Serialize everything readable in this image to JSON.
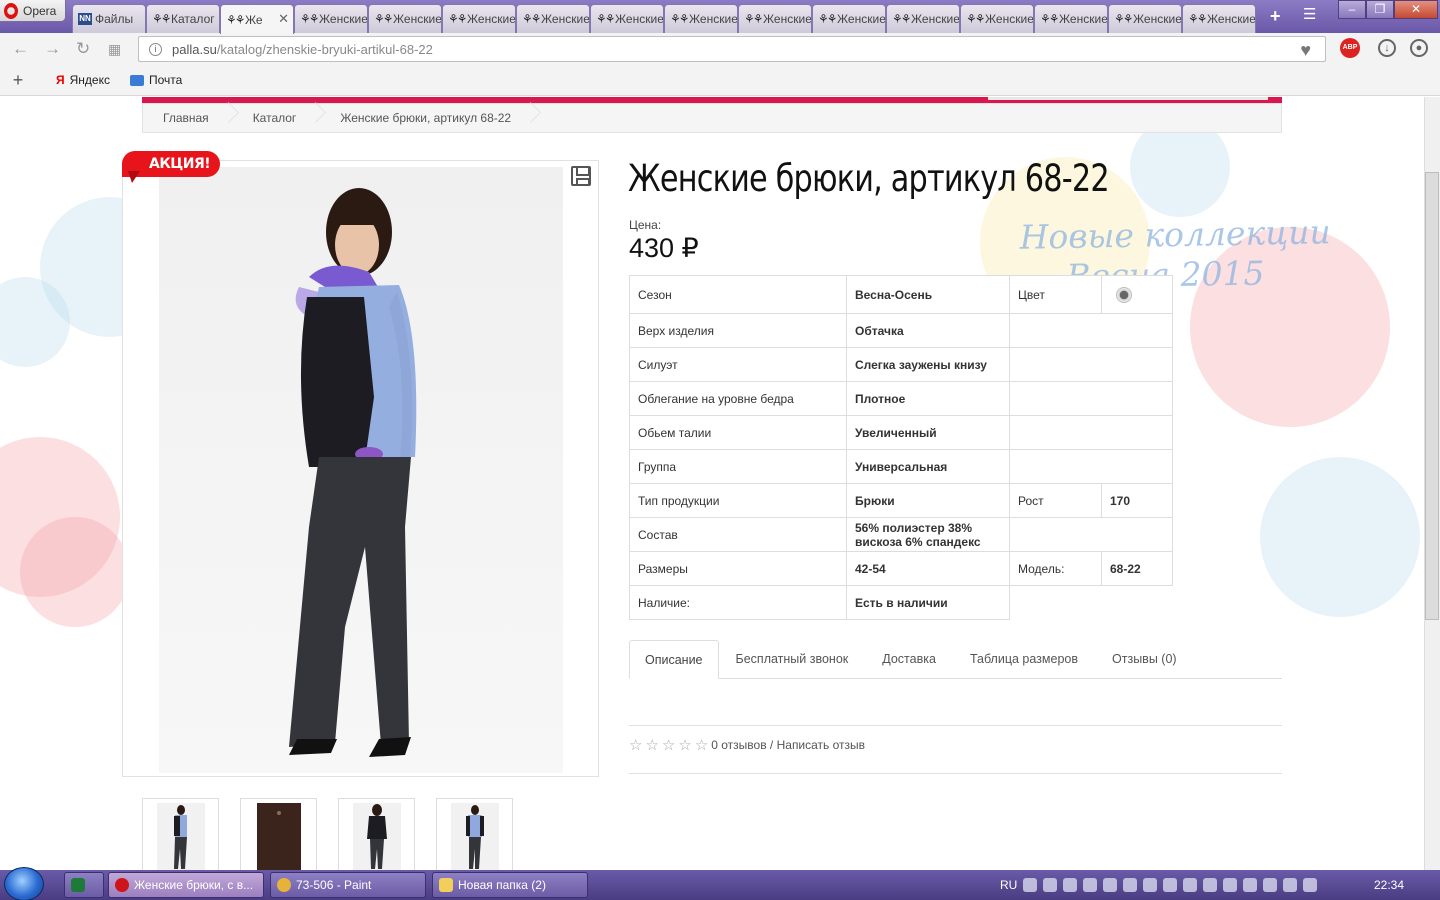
{
  "browser": {
    "menu_label": "Opera",
    "tabs": [
      {
        "icon": "nn",
        "label": "Файлы"
      },
      {
        "icon": "dress-icon",
        "label": "Каталог"
      },
      {
        "icon": "dress-icon",
        "label": "Же",
        "active": true
      },
      {
        "icon": "dress-icon",
        "label": "Женские"
      },
      {
        "icon": "dress-icon",
        "label": "Женские"
      },
      {
        "icon": "dress-icon",
        "label": "Женские"
      },
      {
        "icon": "dress-icon",
        "label": "Женские"
      },
      {
        "icon": "dress-icon",
        "label": "Женские"
      },
      {
        "icon": "dress-icon",
        "label": "Женские"
      },
      {
        "icon": "dress-icon",
        "label": "Женские"
      },
      {
        "icon": "dress-icon",
        "label": "Женские"
      },
      {
        "icon": "dress-icon",
        "label": "Женские"
      },
      {
        "icon": "dress-icon",
        "label": "Женские"
      },
      {
        "icon": "dress-icon",
        "label": "Женские"
      },
      {
        "icon": "dress-icon",
        "label": "Женские"
      },
      {
        "icon": "dress-icon",
        "label": "Женские"
      }
    ],
    "url_host": "palla.su",
    "url_path": "/katalog/zhenskie-bryuki-artikul-68-22",
    "bookmarks": [
      {
        "icon": "yandex-icon",
        "label": "Яндекс"
      },
      {
        "icon": "mail-icon",
        "label": "Почта"
      }
    ],
    "abp_label": "ABP"
  },
  "breadcrumb": [
    "Главная",
    "Каталог",
    "Женские брюки, артикул 68-22"
  ],
  "product": {
    "sale_badge": "АКЦИЯ!",
    "title": "Женские брюки, артикул 68-22",
    "price_label": "Цена:",
    "price": "430 ₽",
    "banner_line1": "Новые коллекции",
    "banner_line2": "Весна 2015",
    "specs": [
      {
        "label": "Сезон",
        "value": "Весна-Осень",
        "label2": "Цвет",
        "value2": "color-dot"
      },
      {
        "label": "Верх изделия",
        "value": "Обтачка"
      },
      {
        "label": "Силуэт",
        "value": "Слегка зауженыкизу"
      },
      {
        "label": "Облегание на уровне бедра",
        "value": "Плотное"
      },
      {
        "label": "Обьем талии",
        "value": "Увеличенный"
      },
      {
        "label": "Группа",
        "value": "Универсальная"
      },
      {
        "label": "Тип продукции",
        "value": "Брюки",
        "label2": "Рост",
        "value2": "170"
      },
      {
        "label": "Состав",
        "value": "56% полиэстер 38% вискоза 6% спандекс"
      },
      {
        "label": "Размеры",
        "value": "42-54",
        "label2": "Модель:",
        "value2": "68-22"
      },
      {
        "label": "Наличие:",
        "value": "Есть в наличии"
      }
    ],
    "tabs": [
      "Описание",
      "Бесплатный звонок",
      "Доставка",
      "Таблица размеров",
      "Отзывы (0)"
    ],
    "reviews_text": "0 отзывов / Написать отзыв",
    "thumbnails": 4
  },
  "taskbar": {
    "items": [
      {
        "icon": "excel-icon",
        "label": ""
      },
      {
        "icon": "opera-icon",
        "label": "Женские брюки, с в...",
        "active": true
      },
      {
        "icon": "paint-icon",
        "label": "73-506 - Paint"
      },
      {
        "icon": "folder-icon",
        "label": "Новая папка (2)"
      }
    ],
    "lang": "RU",
    "clock": "22:34"
  }
}
